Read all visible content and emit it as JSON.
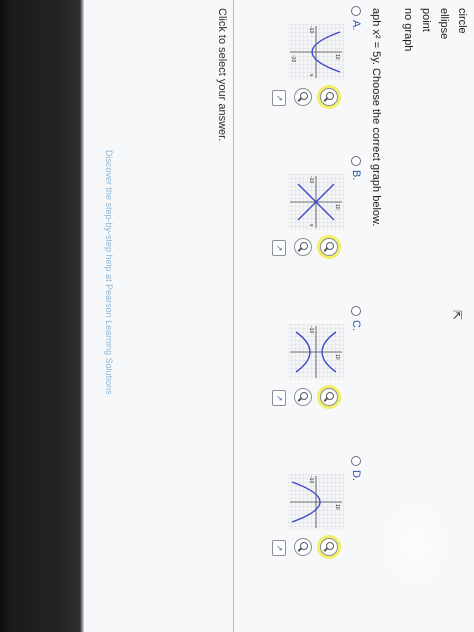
{
  "options_list": [
    "circle",
    "ellipse",
    "point",
    "no graph"
  ],
  "question": "aph x² = 5y. Choose the correct graph below.",
  "choices": [
    {
      "label": "A.",
      "radio_symbol": "○"
    },
    {
      "label": "B.",
      "radio_symbol": "○"
    },
    {
      "label": "C.",
      "radio_symbol": "○"
    },
    {
      "label": "D.",
      "radio_symbol": "○"
    }
  ],
  "mini_graph_ticks": {
    "pos": "10",
    "neg": "-10",
    "x_axis": "x",
    "y_axis": "y"
  },
  "click_note": "Click to select your answer.",
  "footer_note": "Discover the step-by-step help at Pearson Learning Solutions",
  "colors": {
    "accent": "#2c55a8",
    "curve": "#3d49c9",
    "highlight": "#f3ee6a"
  },
  "icons": {
    "zoom": "magnifier-icon",
    "expand": "new-window-icon",
    "cursor": "pointer-cursor-icon"
  }
}
